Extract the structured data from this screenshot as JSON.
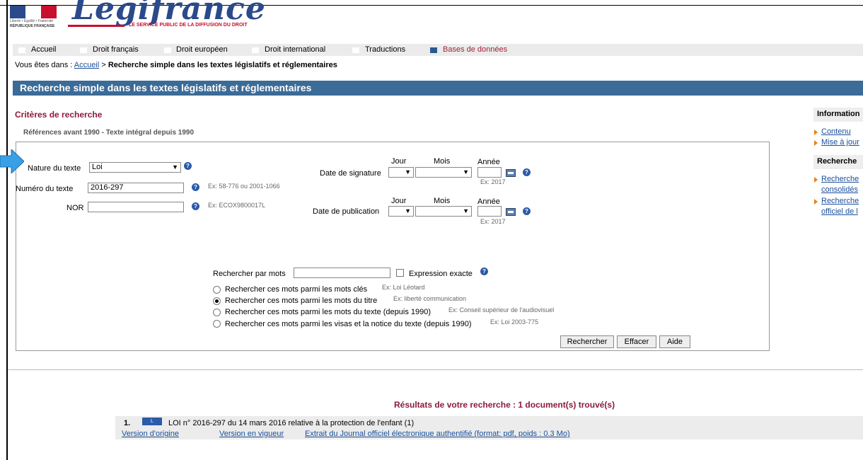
{
  "header": {
    "flag_motto": "Liberté • Égalité • Fraternité",
    "flag_republic": "RÉPUBLIQUE FRANÇAISE",
    "logo": "Legifrance",
    "tagline": "LE SERVICE PUBLIC DE LA DIFFUSION DU DROIT"
  },
  "nav": {
    "items": [
      {
        "label": "Accueil"
      },
      {
        "label": "Droit français"
      },
      {
        "label": "Droit européen"
      },
      {
        "label": "Droit international"
      },
      {
        "label": "Traductions"
      },
      {
        "label": "Bases de données",
        "active": true
      }
    ]
  },
  "breadcrumb": {
    "prefix": "Vous êtes dans :",
    "home": "Accueil",
    "sep": ">",
    "current": "Recherche simple dans les textes législatifs et réglementaires"
  },
  "page_title": "Recherche simple dans les textes législatifs et réglementaires",
  "criteria_title": "Critères de recherche",
  "references_note": "Références avant 1990 - Texte intégral depuis 1990",
  "form": {
    "nature_label": "Nature du texte",
    "nature_value": "Loi",
    "numero_label": "Numéro du texte",
    "numero_value": "2016-297",
    "numero_example": "Ex: 58-776 ou 2001-1066",
    "nor_label": "NOR",
    "nor_value": "",
    "nor_example": "Ex: ECOX9800017L",
    "jour": "Jour",
    "mois": "Mois",
    "annee": "Année",
    "signature_label": "Date de signature",
    "signature_example": "Ex: 2017",
    "publication_label": "Date de publication",
    "publication_example": "Ex: 2017",
    "words_label": "Rechercher par mots",
    "words_value": "",
    "exact_label": "Expression exacte",
    "options": [
      {
        "label": "Rechercher ces mots parmi les mots clés",
        "example": "Ex: Loi Léotard",
        "selected": false
      },
      {
        "label": "Rechercher ces mots parmi les mots du titre",
        "example": "Ex: liberté communication",
        "selected": true
      },
      {
        "label": "Rechercher ces mots parmi les mots du texte (depuis 1990)",
        "example": "Ex: Conseil supérieur de l'audiovisuel",
        "selected": false
      },
      {
        "label": "Rechercher ces mots parmi les visas et la notice du texte (depuis 1990)",
        "example": "Ex: Loi 2003-775",
        "selected": false
      }
    ],
    "search_btn": "Rechercher",
    "clear_btn": "Effacer",
    "help_btn": "Aide",
    "help_glyph": "?"
  },
  "sidebar": {
    "info_title": "Information",
    "links1": [
      "Contenu",
      "Mise à jour"
    ],
    "search_title": "Recherche",
    "links2": [
      "Recherche",
      "consolidés",
      "Recherche",
      "officiel de l"
    ]
  },
  "results": {
    "title": "Résultats de votre recherche : 1 document(s) trouvé(s)",
    "items": [
      {
        "num": "1.",
        "badge": "L",
        "text": "LOI n° 2016-297 du 14 mars 2016 relative à la protection de l'enfant (1)",
        "links": [
          "Version d'origine",
          "Version en vigueur",
          "Extrait du Journal officiel électronique authentifié (format: pdf, poids : 0.3 Mo)"
        ]
      }
    ]
  },
  "colors": {
    "title_band": "#3b6b97",
    "accent_red": "#8b1a3a",
    "link": "#1a4f99",
    "arrow": "#3aa0e6"
  }
}
